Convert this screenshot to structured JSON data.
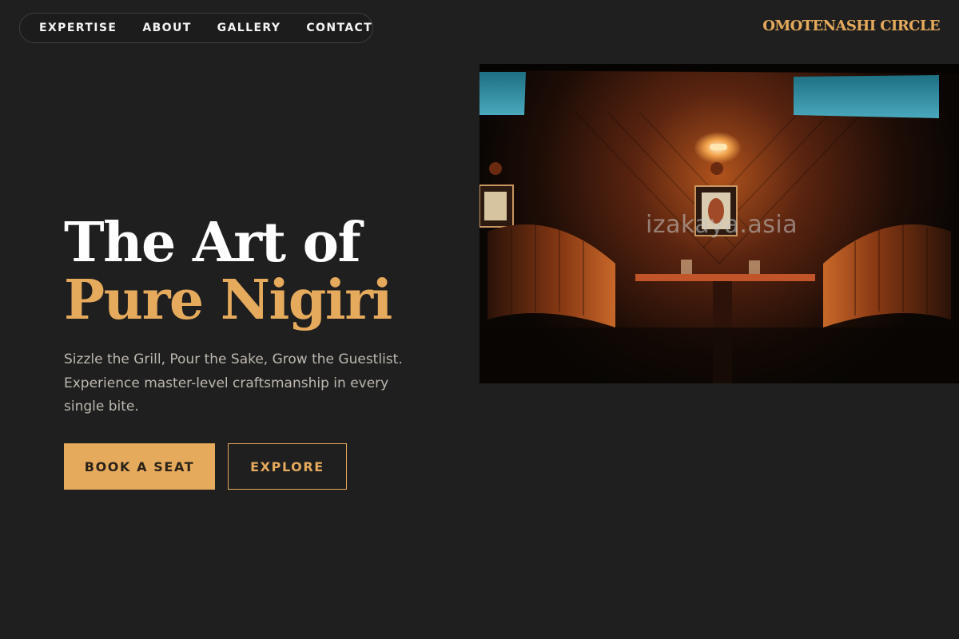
{
  "nav": {
    "items": [
      {
        "label": "EXPERTISE"
      },
      {
        "label": "ABOUT"
      },
      {
        "label": "GALLERY"
      },
      {
        "label": "CONTACT"
      }
    ]
  },
  "brand": {
    "name": "OMOTENASHI CIRCLE"
  },
  "hero": {
    "title_line1": "The Art of",
    "title_line2": "Pure Nigiri",
    "subtitle": "Sizzle the Grill, Pour the Sake, Grow the Guestlist. Experience master-level craftsmanship in every single bite.",
    "primary_button": "BOOK A SEAT",
    "secondary_button": "EXPLORE"
  },
  "photo": {
    "watermark": "izakaya.asia"
  },
  "colors": {
    "background": "#1f1f1f",
    "accent": "#e6aa5c",
    "text": "#ffffff",
    "muted_text": "#bdb8b0"
  }
}
